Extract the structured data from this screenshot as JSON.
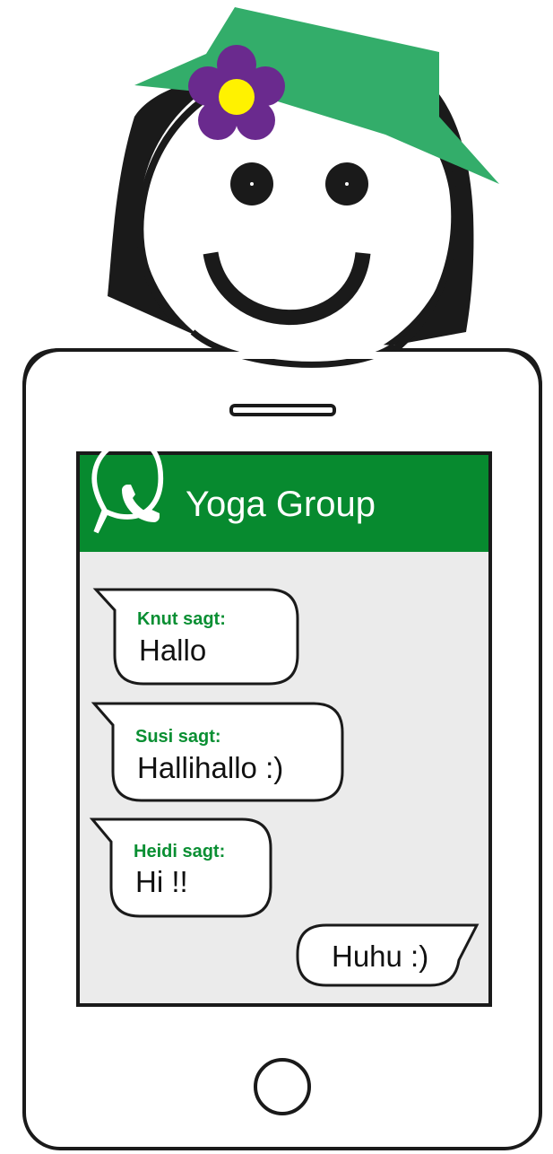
{
  "app": {
    "name_icon": "whatsapp-icon",
    "accent_color": "#078a2f",
    "chat_background": "#ebebeb"
  },
  "chat": {
    "title": "Yoga Group",
    "messages": [
      {
        "sender": "Knut sagt:",
        "text": "Hallo",
        "direction": "incoming"
      },
      {
        "sender": "Susi sagt:",
        "text": "Hallihallo :)",
        "direction": "incoming"
      },
      {
        "sender": "Heidi sagt:",
        "text": "Hi !!",
        "direction": "incoming"
      },
      {
        "sender": "",
        "text": "Huhu :)",
        "direction": "outgoing"
      }
    ]
  },
  "character": {
    "hat_color": "#33ad6a",
    "flower_petal_color": "#6a2a8e",
    "flower_center_color": "#fff200"
  }
}
